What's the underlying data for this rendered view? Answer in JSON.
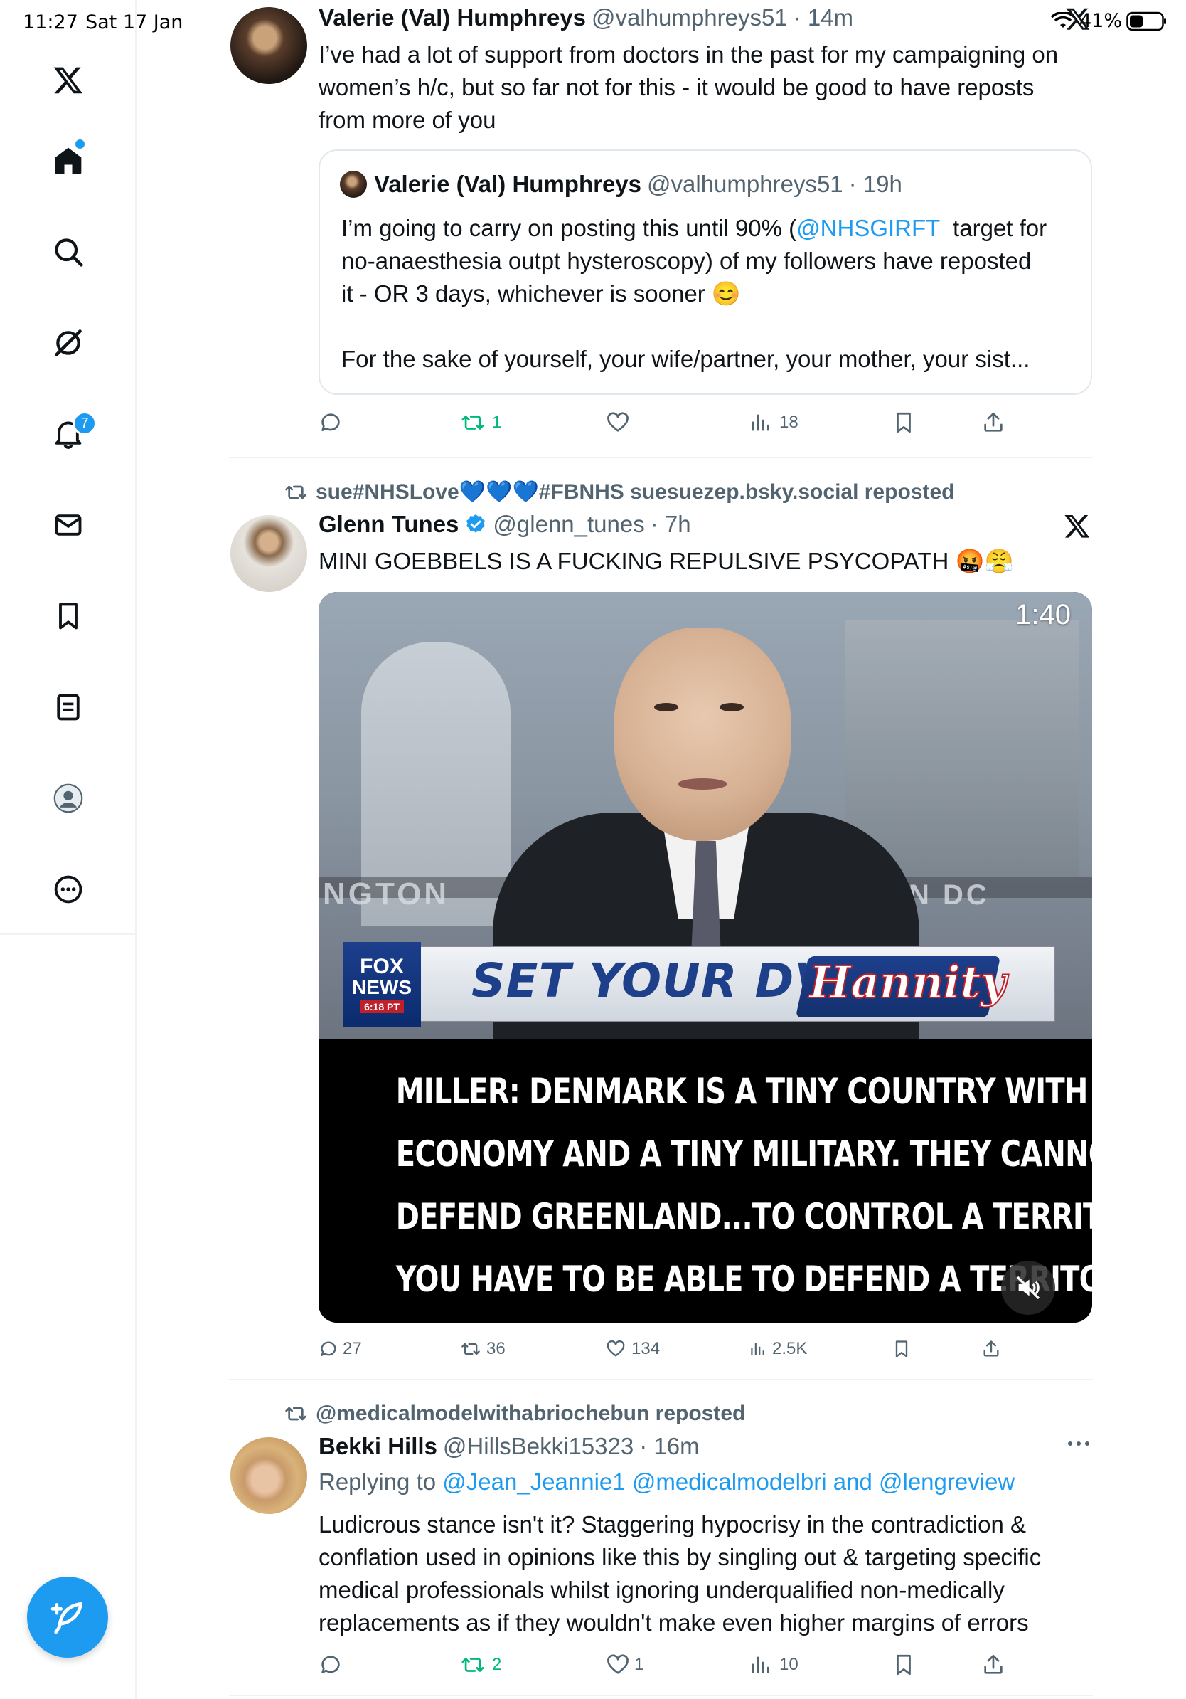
{
  "status_bar": {
    "time": "11:27",
    "date": "Sat 17 Jan",
    "battery": "41%"
  },
  "sidebar": {
    "items": [
      {
        "name": "x-logo-icon"
      },
      {
        "name": "home-icon"
      },
      {
        "name": "search-icon"
      },
      {
        "name": "grok-icon"
      },
      {
        "name": "notifications-icon"
      },
      {
        "name": "messages-icon"
      },
      {
        "name": "bookmarks-icon"
      },
      {
        "name": "lists-icon"
      },
      {
        "name": "profile-icon"
      },
      {
        "name": "more-icon"
      }
    ],
    "notifications_badge": "7",
    "compose_icon": "feather-plus-icon"
  },
  "tweets": [
    {
      "author": "Valerie (Val) Humphreys",
      "handle": "@valhumphreys51",
      "time": "· 14m",
      "text_lines": [
        "I’ve had a lot of support from doctors in the past for my campaigning on",
        "women’s h/c, but so far not for this - it would be good to have reposts",
        "from more of you"
      ],
      "quote": {
        "author": "Valerie (Val) Humphreys",
        "handle": "@valhumphreys51",
        "time": "· 19h",
        "line1_pre": "I’m going to carry on posting this until 90% (",
        "line1_link": "@NHSGIRFT",
        "line1_post": "  target for",
        "line2": "no-anaesthesia outpt hysteroscopy) of my followers have reposted",
        "line3": "it - OR 3 days, whichever is sooner 😊",
        "line4": "For the sake of yourself, your wife/partner, your mother, your sist..."
      },
      "stats": {
        "replies": "",
        "reposts": "1",
        "likes": "",
        "views": "18"
      }
    },
    {
      "repost_by": "sue#NHSLove💙💙💙#FBNHS suesuezep.bsky.social reposted",
      "author": "Glenn Tunes",
      "handle": "@glenn_tunes",
      "time": "· 7h",
      "text": "MINI GOEBBELS IS A FUCKING REPULSIVE PSYCOPATH 🤬😤",
      "video": {
        "duration": "1:40",
        "backdrop_left": "NGTON",
        "backdrop_right": "N DC",
        "network_line1": "FOX",
        "network_line2": "NEWS",
        "network_time": "6:18 PT",
        "banner_text": "SET YOUR DVR",
        "show_logo": "Hannity",
        "caption_lines": [
          "MILLER: DENMARK IS A TINY COUNTRY WITH A TINY",
          "ECONOMY AND A TINY MILITARY. THEY CANNOT",
          "DEFEND GREENLAND...TO CONTROL A TERRITORY",
          "YOU HAVE TO BE ABLE TO DEFEND A TERRITORY..."
        ]
      },
      "stats": {
        "replies": "27",
        "reposts": "36",
        "likes": "134",
        "views": "2.5K"
      }
    },
    {
      "repost_by": "@medicalmodelwithabriochebun reposted",
      "author": "Bekki Hills",
      "handle": "@HillsBekki15323",
      "time": "· 16m",
      "replying_label": "Replying to",
      "replying_to_1": "@Jean_Jeannie1",
      "replying_to_2": "@medicalmodelbri",
      "replying_and": "and",
      "replying_to_3": "@lengreview",
      "text_lines": [
        "Ludicrous stance isn't it? Staggering hypocrisy in the contradiction &",
        "conflation used in opinions like this by singling out & targeting specific",
        "medical professionals whilst ignoring underqualified non-medically",
        "replacements as if they wouldn't make even higher margins of errors"
      ],
      "stats": {
        "replies": "",
        "reposts": "2",
        "likes": "1",
        "views": "10"
      }
    }
  ],
  "colors": {
    "accent": "#1d9bf0",
    "repost": "#00ba7c",
    "muted": "#536471",
    "text": "#0f1419"
  }
}
